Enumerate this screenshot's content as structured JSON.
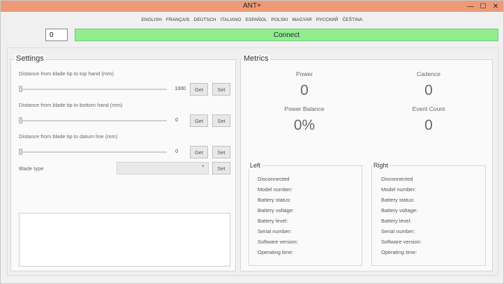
{
  "window": {
    "title": "ANT+",
    "minimize": "—",
    "maximize": "☐",
    "close": "✕"
  },
  "languages": [
    "ENGLISH",
    "FRANÇAIS",
    "DEUTSCH",
    "ITALIANO",
    "ESPAÑOL",
    "POLSKI",
    "MAGYAR",
    "РУССКИЙ",
    "ČEŠTINA"
  ],
  "connection": {
    "device_id": "0",
    "connect_label": "Connect"
  },
  "settings": {
    "title": "Settings",
    "sliders": [
      {
        "label": "Distance from blade tip to top hand (mm)",
        "value": "1000"
      },
      {
        "label": "Distance from blade tip to bottom hand (mm)",
        "value": "0"
      },
      {
        "label": "Distance from blade tip to datum line (mm)",
        "value": "0"
      }
    ],
    "get_label": "Get",
    "set_label": "Set",
    "blade_type_label": "Blade type",
    "blade_type_value": ""
  },
  "metrics": {
    "title": "Metrics",
    "power": {
      "label": "Power",
      "value": "0"
    },
    "cadence": {
      "label": "Cadence",
      "value": "0"
    },
    "power_balance": {
      "label": "Power Balance",
      "value": "0%"
    },
    "event_count": {
      "label": "Event Count",
      "value": "0"
    }
  },
  "left": {
    "title": "Left",
    "status": "Disconnected",
    "fields": [
      "Model number:",
      "Battery status:",
      "Battery voltage:",
      "Battery level:",
      "Serial number:",
      "Software version:",
      "Operating time:"
    ]
  },
  "right": {
    "title": "Right",
    "status": "Disconnected",
    "fields": [
      "Model number:",
      "Battery status:",
      "Battery voltage:",
      "Battery level:",
      "Serial number:",
      "Software version:",
      "Operating time:"
    ]
  },
  "colors": {
    "titlebar": "#ee9a76",
    "connect": "#90ee90"
  }
}
